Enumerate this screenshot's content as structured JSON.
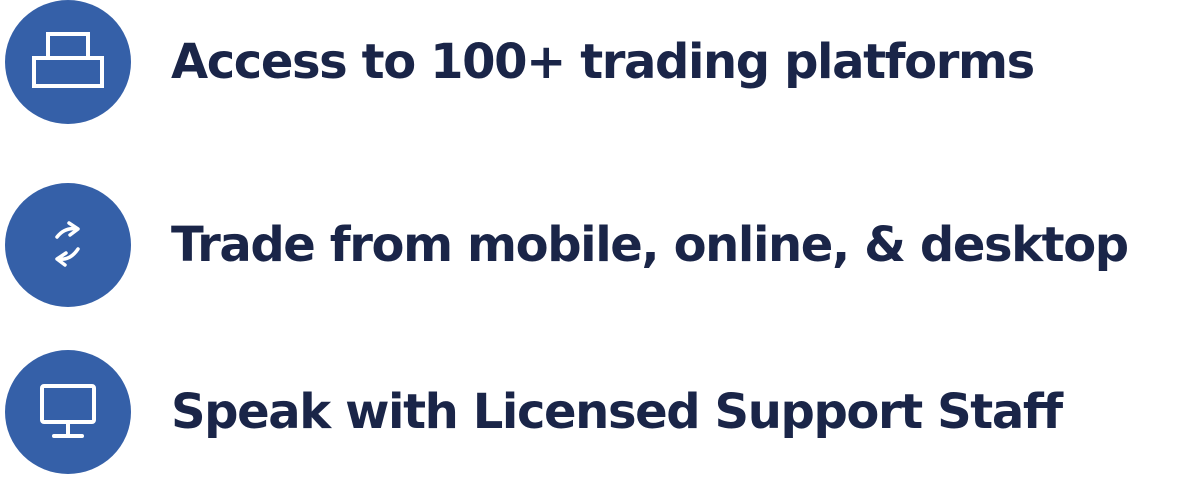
{
  "features": [
    {
      "icon": "platform-window-icon",
      "label": "Access to 100+ trading platforms"
    },
    {
      "icon": "swap-arrows-icon",
      "label": "Trade from mobile, online, & desktop"
    },
    {
      "icon": "monitor-icon",
      "label": "Speak with Licensed Support Staff"
    }
  ],
  "colors": {
    "icon_background": "#3560a8",
    "icon_stroke": "#ffffff",
    "text": "#1a2548"
  }
}
